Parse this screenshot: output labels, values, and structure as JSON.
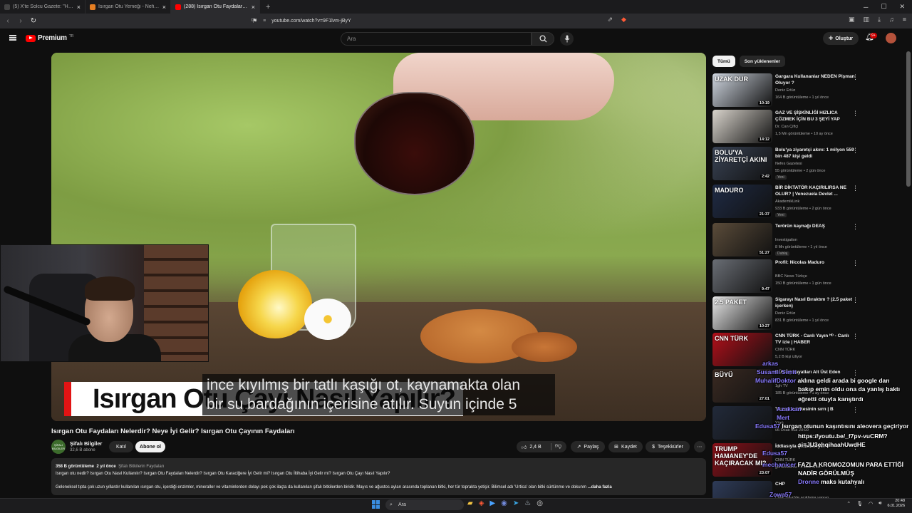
{
  "browser": {
    "tabs": [
      {
        "label": "(5) X'te Solcu Gazete: \"Hindistan'a gi",
        "active": false,
        "color": "#222222"
      },
      {
        "label": "Isırgan Otu Yemeği - Nefis Yemek Tar",
        "active": false,
        "color": "#e67e22"
      },
      {
        "label": "(288) Isırgan Otu Faydaları Neler",
        "active": true,
        "color": "#ff0000"
      }
    ],
    "url": "youtube.com/watch?v=9F1lvm-jByY"
  },
  "youtube": {
    "logo_text": "Premium",
    "logo_sup": "TR",
    "search_placeholder": "Ara",
    "create_label": "Oluştur",
    "notif_count": "9+"
  },
  "video": {
    "title_card": "Isırgan Otu Çayı Nasıl Yapılır?",
    "subtitle_line1": "ince kıyılmış bir tatlı kaşığı ot, kaynamakta olan",
    "subtitle_line2": "bir su bardağının içerisine atılır. Suyun içinde 5",
    "title": "Isırgan Otu Faydaları Nelerdir? Neye İyi Gelir? Isırgan Otu Çayının Faydaları",
    "channel": "Şifalı Bilgiler",
    "channel_avatar_text": "ŞİFALI BİLGİLER",
    "subscribers": "32,6 B abone",
    "join_label": "Katıl",
    "subscribe_label": "Abone ol",
    "likes": "2,4 B",
    "share_label": "Paylaş",
    "save_label": "Kaydet",
    "thanks_label": "Teşekkürler",
    "views": "358 B görüntüleme",
    "age": "2 yıl önce",
    "tags": "Şifalı Bitkilerin Faydaları",
    "desc_line1": "Isırgan otu nedir? Isırgan Otu Nasıl Kullanılır? Isırgan Otu Faydaları Nelerdir? Isırgan Otu Karaciğere İyi Gelir mi? Isırgan Otu İltihaba İyi Gelir mi? Isırgan Otu Çayı Nasıl Yapılır?",
    "desc_line2": "Geleneksel tıpta çok uzun yıllardır kullanılan ısırgan otu, içerdiği enzimler, mineraller ve vitaminlerden dolayı pek çok ilaçta da kullanılan şifalı bitkilerden biridir. Mayıs ve ağustos ayları arasında toplanan bitki, her tür toprakta yetişir. Bilimsel adı 'Urtica' olan bitki sürtünme ve dokunm",
    "desc_more": "...daha fazla"
  },
  "sidebar": {
    "chips": [
      "Tümü",
      "Son yüklenenler"
    ],
    "items": [
      {
        "title": "Gargara Kullananlar NEDEN Pişman Oluyor ?",
        "channel": "Deniz Ertüz",
        "meta": "164 B görüntüleme • 1 yıl önce",
        "duration": "10:19",
        "thumb_caption": "UZAK DUR",
        "bg": "#cfd6e0",
        "new": ""
      },
      {
        "title": "GAZ VE ŞİŞKİNLİĞİ HIZLICA ÇÖZMEK İÇİN BU 3 ŞEYİ YAP",
        "channel": "Dr. Can Çiftçi",
        "meta": "1,5 Mn görüntüleme • 10 ay önce",
        "duration": "14:12",
        "thumb_caption": "",
        "bg": "#d9d4cc",
        "new": ""
      },
      {
        "title": "Bolu'ya ziyaretçi akını: 1 milyon 559 bin 487 kişi geldi",
        "channel": "Nefes Gazetesi",
        "meta": "55 görüntüleme • 2 gün önce",
        "duration": "2:42",
        "thumb_caption": "BOLU'YA ZİYARETÇİ AKINI",
        "bg": "#3a4456",
        "new": "Yeni"
      },
      {
        "title": "BİR DİKTATÖR KAÇIRILIRSA NE OLUR? | Venezuela Devlet ...",
        "channel": "AkademikLink",
        "meta": "933 B görüntüleme • 2 gün önce",
        "duration": "21:37",
        "thumb_caption": "MADURO",
        "bg": "#1f2b45",
        "new": "Yeni"
      },
      {
        "title": "Terörün kaynağı DEAŞ",
        "channel": "Investigation",
        "meta": "8 Mn görüntüleme • 1 yıl önce",
        "duration": "51:27",
        "thumb_caption": "",
        "bg": "#5b4c3a",
        "new": "Dublaj"
      },
      {
        "title": "Profil: Nicolas Maduro",
        "channel": "BBC News Türkçe",
        "meta": "150 B görüntüleme • 1 gün önce",
        "duration": "9:47",
        "thumb_caption": "",
        "bg": "#6a6e75",
        "new": ""
      },
      {
        "title": "Sigarayı Nasıl Bıraktım ? (2.5 paket içerken)",
        "channel": "Deniz Ertüz",
        "meta": "831 B görüntüleme • 1 yıl önce",
        "duration": "10:27",
        "thumb_caption": "2.5 PAKET",
        "bg": "#e8e8e8",
        "new": ""
      },
      {
        "title": "CNN TÜRK - Canlı Yayın ᴴᴰ - Canlı TV izle | HABER",
        "channel": "CNN TÜRK",
        "meta": "5,2 B kişi izliyor",
        "duration": "",
        "thumb_caption": "CNN TÜRK",
        "bg": "#b3101a",
        "new": ""
      },
      {
        "title": "BÜYÜ | Hayatları Alt Üst Eden",
        "channel": "1gh TV",
        "meta": "185 B görüntüleme • 1 ay önce",
        "duration": "27:01",
        "thumb_caption": "BÜYÜ",
        "bg": "#3a2a22",
        "new": ""
      },
      {
        "title": "Trump'ın öfkesinin sırrı | B",
        "channel": "Yürü",
        "meta": "06 Ocak Salı 20:00",
        "duration": "",
        "thumb_caption": "",
        "bg": "#222a3a",
        "new": ""
      },
      {
        "title": "İddiasıyla Çalkalanıyor",
        "channel": "CNN TÜRK",
        "meta": "görüntüleme • 4 saat önce",
        "duration": "23:07",
        "thumb_caption": "TRUMP HAMANEY'DE KAÇIRACAK MI?",
        "bg": "#8b1018",
        "new": ""
      },
      {
        "title": "CHP",
        "channel": "Çelik Silivri'de açıklama yapıyo",
        "meta": "",
        "duration": "",
        "thumb_caption": "",
        "bg": "#2e3b58",
        "new": ""
      }
    ]
  },
  "chat": [
    {
      "user": "arkas",
      "text": ""
    },
    {
      "user": "Susamlı Simit",
      "text": ""
    },
    {
      "user": "MuhalifDoktor",
      "text": "aklına geldi arada bi google dan"
    },
    {
      "user": "",
      "text": "bakıp emin oldu ona da yanlış baktı"
    },
    {
      "user": "",
      "text": "eğretti otuyla karıştırdı"
    },
    {
      "user": "Azakkan",
      "text": ""
    },
    {
      "user": "Mert",
      "text": ""
    },
    {
      "user": "Edusa57",
      "text": "Isırgan otunun kaşıntısını aleovera geçiriyor."
    },
    {
      "user": "",
      "text": "https://youtu.be/_f7pv-vuCRM?"
    },
    {
      "user": "",
      "text": "si=JU3ehqihaahUwdHE"
    },
    {
      "user": "Edusa57",
      "text": ""
    },
    {
      "user": "mechanicer",
      "text": "FAZLA KROMOZOMUN PARA ETTİĞİ"
    },
    {
      "user": "",
      "text": "NADİR GÖRÜLMÜŞ"
    },
    {
      "user": "Dronne",
      "text": "maks kutahyalı"
    },
    {
      "user": "Zowa57",
      "text": ""
    }
  ],
  "taskbar": {
    "search_label": "Ara",
    "time": "20:48",
    "date": "6.01.2026"
  }
}
